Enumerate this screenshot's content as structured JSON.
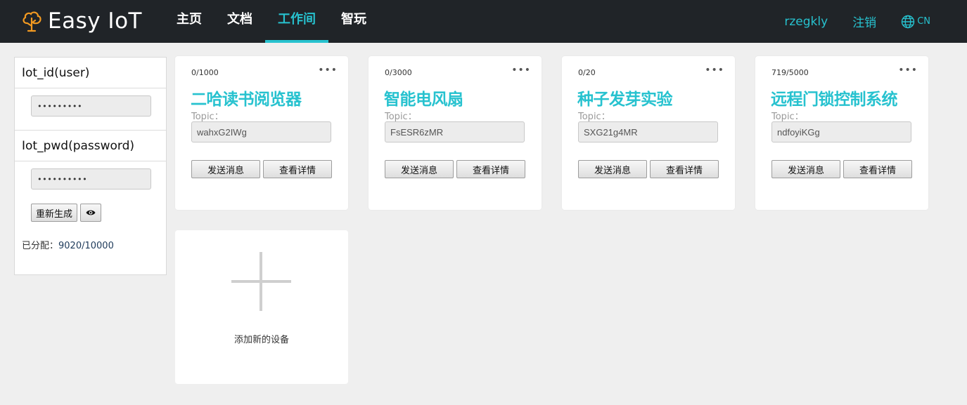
{
  "header": {
    "brand": "Easy IoT",
    "nav": [
      "主页",
      "文档",
      "工作间",
      "智玩"
    ],
    "active_nav": "工作间",
    "username": "rzegkly",
    "logout": "注销",
    "lang": "CN",
    "accent_color": "#27c2cf",
    "brand_icon_color": "#f39a21"
  },
  "sidebar": {
    "user_title": "Iot_id(user)",
    "user_value": "•••••••••",
    "pwd_title": "Iot_pwd(password)",
    "pwd_value": "••••••••••",
    "regenerate_label": "重新生成",
    "eye_icon": "eye-icon",
    "allocated_label": "已分配：",
    "allocated_value": "9020/10000"
  },
  "devices": [
    {
      "count": "0/1000",
      "name": "二哈读书阅览器",
      "topic_label": "Topic：",
      "topic": "wahxG2IWg",
      "send_label": "发送消息",
      "detail_label": "查看详情",
      "menu": "•••"
    },
    {
      "count": "0/3000",
      "name": "智能电风扇",
      "topic_label": "Topic：",
      "topic": "FsESR6zMR",
      "send_label": "发送消息",
      "detail_label": "查看详情",
      "menu": "•••"
    },
    {
      "count": "0/20",
      "name": "种子发芽实验",
      "topic_label": "Topic：",
      "topic": "SXG21g4MR",
      "send_label": "发送消息",
      "detail_label": "查看详情",
      "menu": "•••"
    },
    {
      "count": "719/5000",
      "name": "远程门锁控制系统",
      "topic_label": "Topic：",
      "topic": "ndfoyiKGg",
      "send_label": "发送消息",
      "detail_label": "查看详情",
      "menu": "•••"
    }
  ],
  "add_device": {
    "label": "添加新的设备"
  }
}
